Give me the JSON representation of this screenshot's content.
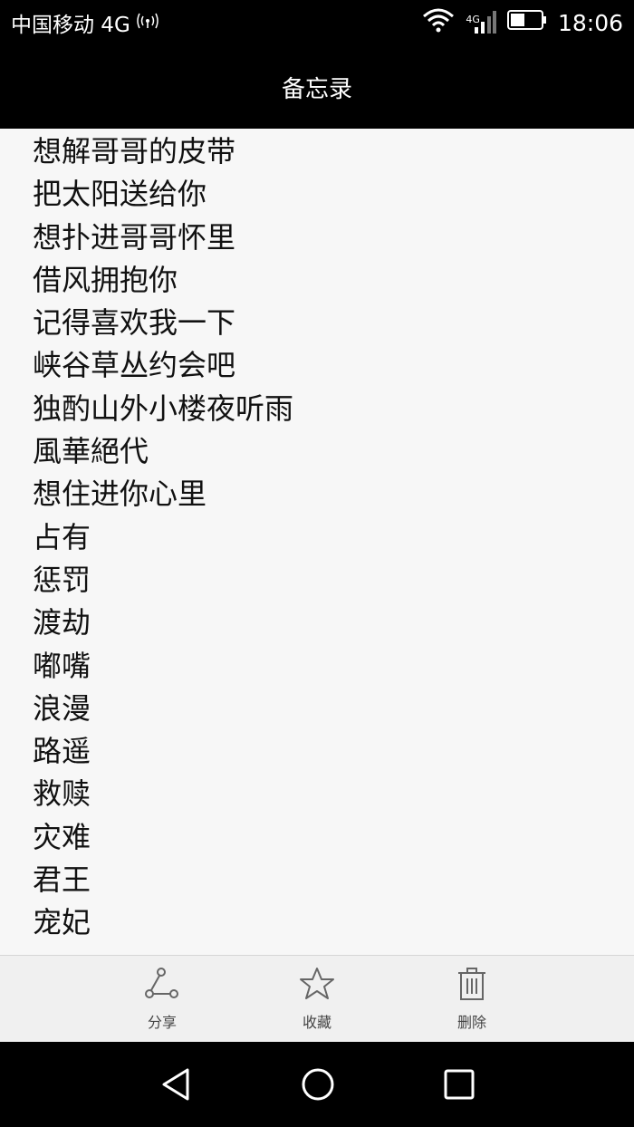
{
  "status_bar": {
    "carrier": "中国移动 4G",
    "network_tag": "4G",
    "time": "18:06"
  },
  "title_bar": {
    "title": "备忘录"
  },
  "note": {
    "lines": [
      "想解哥哥的皮带",
      "把太阳送给你",
      "想扑进哥哥怀里",
      "借风拥抱你",
      "记得喜欢我一下",
      "峡谷草丛约会吧",
      "独酌山外小楼夜听雨",
      "風華絕代",
      "想住进你心里",
      "占有",
      "惩罚",
      "渡劫",
      "嘟嘴",
      "浪漫",
      "路遥",
      "救赎",
      "灾难",
      "君王",
      "宠妃"
    ]
  },
  "actions": {
    "share": {
      "label": "分享",
      "icon": "share-icon"
    },
    "favorite": {
      "label": "收藏",
      "icon": "star-icon"
    },
    "delete": {
      "label": "删除",
      "icon": "trash-icon"
    }
  },
  "nav": {
    "back_icon": "back-triangle-icon",
    "home_icon": "home-circle-icon",
    "recents_icon": "recents-square-icon"
  }
}
